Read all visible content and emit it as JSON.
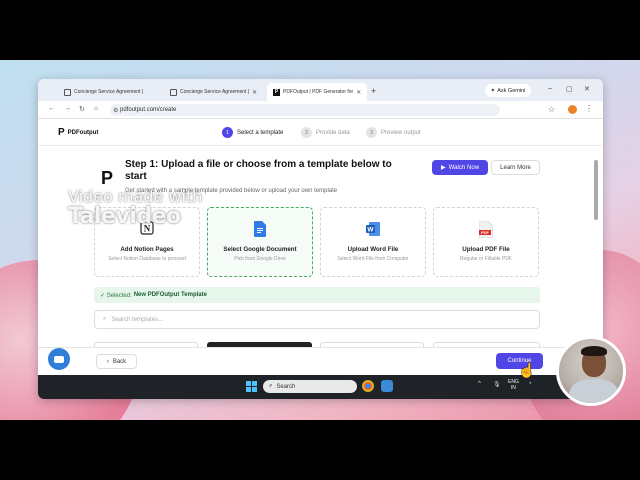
{
  "browser": {
    "tabs": [
      {
        "label": "Concierge Service Agreement |"
      },
      {
        "label": "Concierge Service Agreement |"
      },
      {
        "label": "PDFOutput | PDF Generator for"
      }
    ],
    "ask_gemini": "Ask Gemini",
    "url": "pdfoutput.com/create",
    "profile_initial": "K"
  },
  "app": {
    "logo": "PDFoutput",
    "steps": [
      {
        "num": "1",
        "label": "Select a template"
      },
      {
        "num": "2",
        "label": "Provide data"
      },
      {
        "num": "3",
        "label": "Preview output"
      }
    ],
    "title_a": "Step 1: Upload a file or choose from a template below to",
    "title_b": "start",
    "subtitle": "Get started with a sample template provided below or upload your own template",
    "watch_now": "Watch Now",
    "learn_more": "Learn More",
    "cards": [
      {
        "title": "Add Notion Pages",
        "desc": "Select Notion Database to proceed"
      },
      {
        "title": "Select Google Document",
        "desc": "Pick from Google Drive"
      },
      {
        "title": "Upload Word File",
        "desc": "Select Word File from Computer"
      },
      {
        "title": "Upload PDF File",
        "desc": "Regular or Fillable PDF"
      }
    ],
    "selected_prefix": "✓ Selected:",
    "selected_value": "New PDFOutput Template",
    "search_placeholder": "Search templates...",
    "back": "Back",
    "continue": "Continue"
  },
  "taskbar": {
    "search": "Search",
    "lang_1": "ENG",
    "lang_2": "IN"
  },
  "watermark": {
    "line1": "Video made with",
    "line2": "Talevideo"
  },
  "colors": {
    "accent": "#4f46e5",
    "success_bg": "#e7f6eb",
    "success_text": "#2d7a43"
  }
}
